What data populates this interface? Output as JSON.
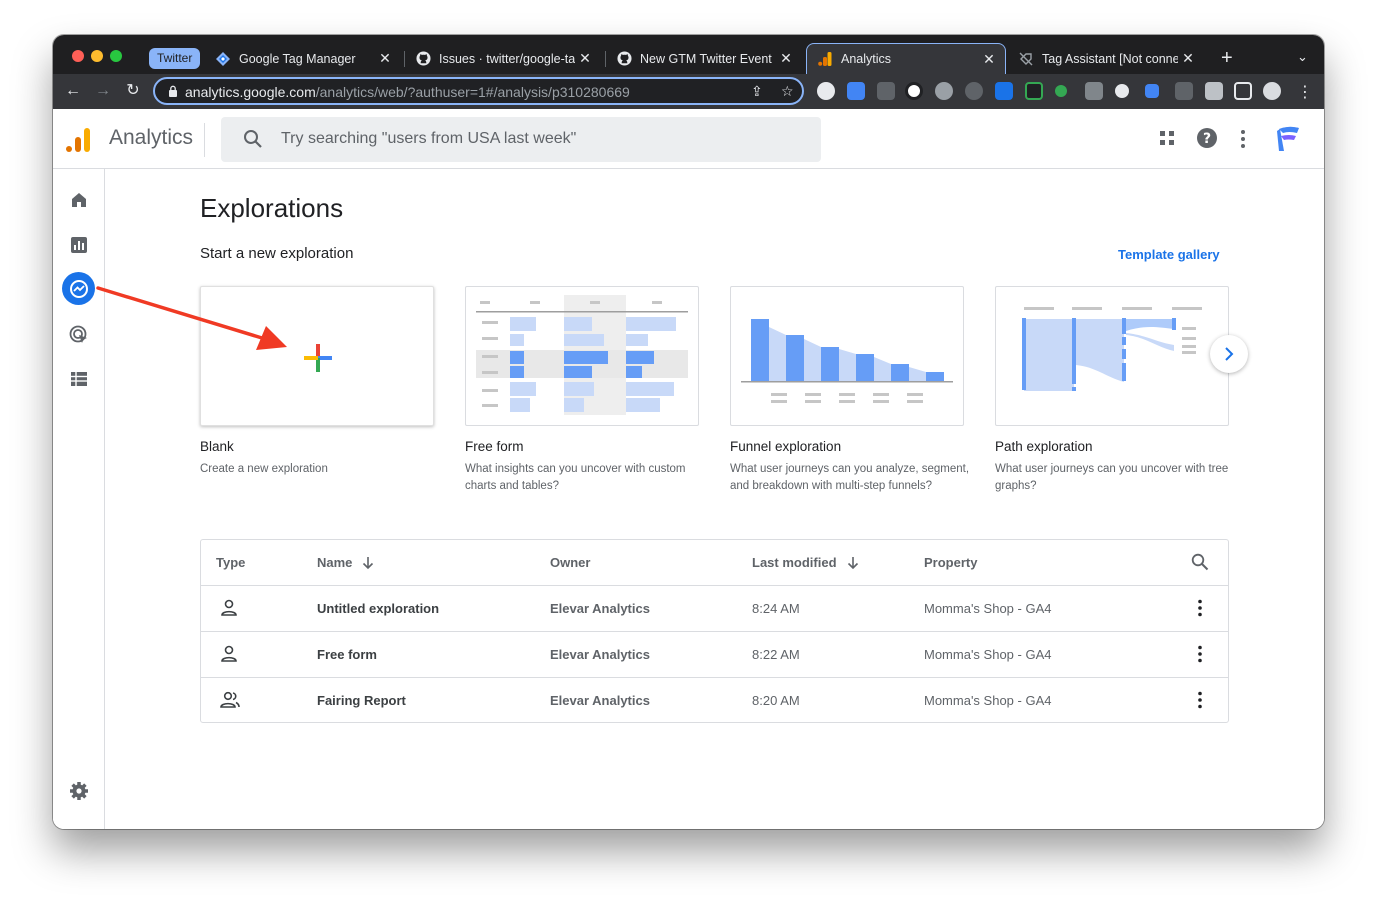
{
  "browser": {
    "tab_group_label": "Twitter",
    "tabs": [
      {
        "label": "Google Tag Manager",
        "icon": "tag-manager-icon"
      },
      {
        "label": "Issues · twitter/google-tag",
        "icon": "github-icon"
      },
      {
        "label": "New GTM Twitter Event Pi",
        "icon": "github-icon"
      },
      {
        "label": "Analytics",
        "icon": "analytics-icon",
        "active": true
      },
      {
        "label": "Tag Assistant [Not connec",
        "icon": "tag-assistant-icon"
      }
    ],
    "url_host": "analytics.google.com",
    "url_path": "/analytics/web/?authuser=1#/analysis/p310280669"
  },
  "app": {
    "title": "Analytics",
    "search_placeholder": "Try searching \"users from USA last week\""
  },
  "page": {
    "title": "Explorations",
    "subtitle": "Start a new exploration",
    "template_gallery": "Template gallery"
  },
  "cards": [
    {
      "title": "Blank",
      "desc": "Create a new exploration"
    },
    {
      "title": "Free form",
      "desc": "What insights can you uncover with custom charts and tables?"
    },
    {
      "title": "Funnel exploration",
      "desc": "What user journeys can you analyze, segment, and breakdown with multi-step funnels?"
    },
    {
      "title": "Path exploration",
      "desc": "What user journeys can you uncover with tree graphs?"
    }
  ],
  "table": {
    "headers": {
      "type": "Type",
      "name": "Name",
      "owner": "Owner",
      "modified": "Last modified",
      "property": "Property"
    },
    "rows": [
      {
        "name": "Untitled exploration",
        "owner": "Elevar Analytics",
        "modified": "8:24 AM",
        "property": "Momma's Shop - GA4",
        "icon": "person-icon"
      },
      {
        "name": "Free form",
        "owner": "Elevar Analytics",
        "modified": "8:22 AM",
        "property": "Momma's Shop - GA4",
        "icon": "person-icon"
      },
      {
        "name": "Fairing Report",
        "owner": "Elevar Analytics",
        "modified": "8:20 AM",
        "property": "Momma's Shop - GA4",
        "icon": "shared-people-icon"
      }
    ]
  },
  "colors": {
    "accent": "#1a73e8",
    "annotation_arrow": "#f03a24",
    "chrome_dark": "#35363a"
  }
}
